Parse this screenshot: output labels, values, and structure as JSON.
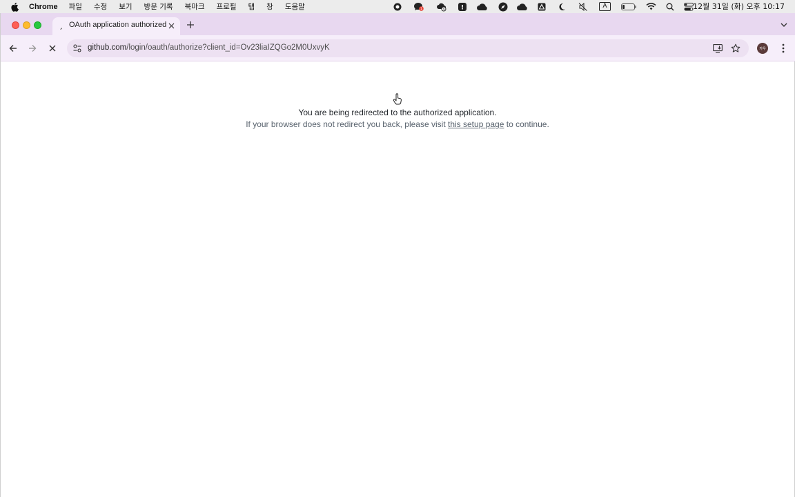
{
  "menubar": {
    "app_name": "Chrome",
    "items": [
      "파일",
      "수정",
      "보기",
      "방문 기록",
      "북마크",
      "프로필",
      "탭",
      "창",
      "도움말"
    ],
    "clock": "12월 31일 (화) 오후 10:17",
    "input_indicator": "A",
    "notification_badge": "1"
  },
  "tab": {
    "title": "OAuth application authorized"
  },
  "omnibox": {
    "host": "github.com",
    "path": "/login/oauth/authorize?client_id=Ov23liaIZQGo2M0UxvyK"
  },
  "profile": {
    "avatar_text": "카우"
  },
  "page": {
    "message": "You are being redirected to the authorized application.",
    "sub_prefix": "If your browser does not redirect you back, please visit ",
    "sub_link": "this setup page",
    "sub_suffix": " to continue."
  },
  "colors": {
    "tabstrip": "#e8d8f0",
    "toolbar": "#f6eefa",
    "omnibox": "#ede1f2"
  }
}
